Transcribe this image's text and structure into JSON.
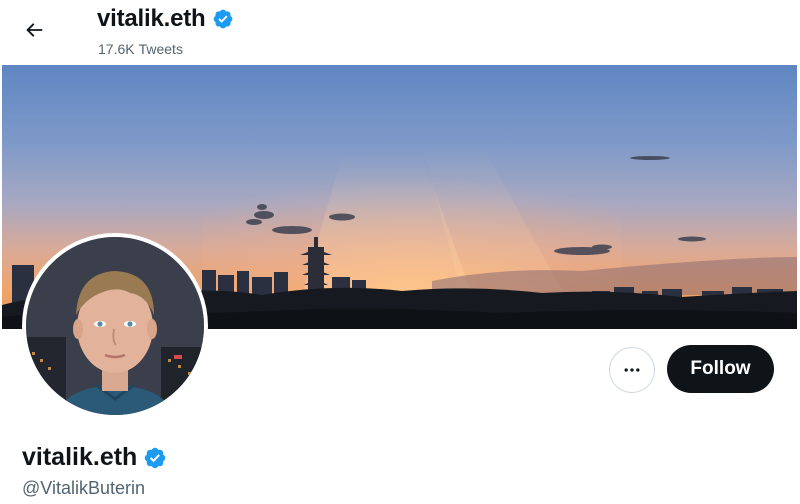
{
  "header": {
    "display_name": "vitalik.eth",
    "tweet_count": "17.6K",
    "tweets_label": "Tweets",
    "back_icon": "arrow-left-icon",
    "verified_icon": "verified-badge-icon"
  },
  "profile": {
    "display_name": "vitalik.eth",
    "handle": "@VitalikButerin",
    "verified": true
  },
  "actions": {
    "more_icon": "more-horizontal-icon",
    "follow_label": "Follow"
  },
  "colors": {
    "verified_blue": "#1d9bf0",
    "follow_button_bg": "#0f1419",
    "secondary_text": "#536471"
  }
}
